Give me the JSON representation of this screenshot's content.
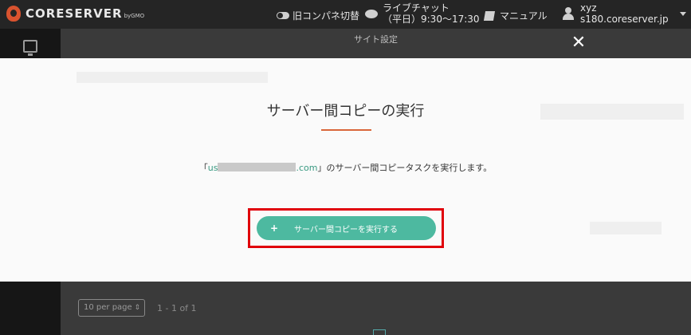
{
  "header": {
    "logo_text": "CORESERVER",
    "logo_sub": "byGMO",
    "old_panel_toggle": "旧コンパネ切替",
    "live_chat_title": "ライブチャット",
    "live_chat_hours": "（平日）9:30〜17:30",
    "manual": "マニュアル",
    "user_name": "xyz",
    "user_server": "s180.coreserver.jp"
  },
  "modal": {
    "header_title": "サイト設定",
    "close_symbol": "✕",
    "title": "サーバー間コピーの実行",
    "message_open": "「",
    "domain_prefix": "us",
    "domain_suffix": ".com",
    "message_rest": "」のサーバー間コピータスクを実行します。",
    "button_icon": "+",
    "button_label": "サーバー間コピーを実行する"
  },
  "pagination": {
    "per_page": "10 per page",
    "range": "1 - 1 of 1"
  },
  "colors": {
    "accent_green": "#4db9a0",
    "accent_orange": "#d9663a",
    "highlight_red": "#e0000a"
  }
}
